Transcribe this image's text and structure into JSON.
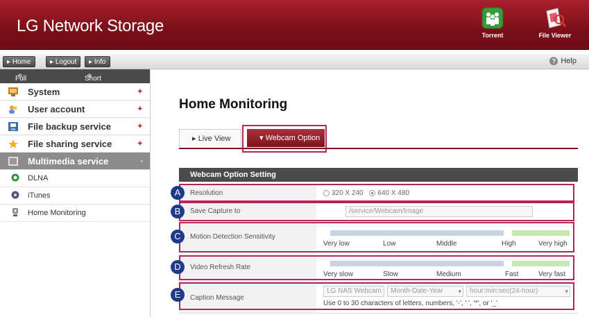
{
  "header": {
    "title": "LG Network Storage",
    "torrent_label": "Torrent",
    "fileviewer_label": "File Viewer"
  },
  "toolbar": {
    "home": "Home",
    "logout": "Logout",
    "info": "Info",
    "help": "Help"
  },
  "sidebar": {
    "full_menu": "Full Menu",
    "short_menu": "Short Menu",
    "categories": [
      {
        "label": "System"
      },
      {
        "label": "User account"
      },
      {
        "label": "File backup service"
      },
      {
        "label": "File sharing service"
      },
      {
        "label": "Multimedia service"
      }
    ],
    "sub_items": [
      {
        "label": "DLNA"
      },
      {
        "label": "iTunes"
      },
      {
        "label": "Home Monitoring"
      }
    ]
  },
  "main": {
    "title": "Home Monitoring",
    "tabs": [
      {
        "label": "Live View"
      },
      {
        "label": "Webcam Option"
      }
    ],
    "section_title": "Webcam Option Setting",
    "resolution": {
      "label": "Resolution",
      "option1": "320 X 240",
      "option2": "640 X 480",
      "selected": "640 X 480"
    },
    "save_capture": {
      "label": "Save Capture to",
      "value": "/service/Webcam/Image"
    },
    "motion": {
      "label": "Motion Detection Sensitivity",
      "ticks": [
        "Very low",
        "Low",
        "Middle",
        "High",
        "Very high"
      ]
    },
    "refresh": {
      "label": "Video Refresh Rate",
      "ticks": [
        "Very slow",
        "Slow",
        "Medium",
        "Fast",
        "Very fast"
      ]
    },
    "caption": {
      "label": "Caption Message",
      "text_value": "LG NAS Webcam",
      "date_format": "Month-Date-Year",
      "time_format": "hour:min:sec(24-hour)",
      "hint": "Use 0 to 30 characters of letters, numbers, '-', ' ', '*', or '_'"
    },
    "badges": [
      "A",
      "B",
      "C",
      "D",
      "E"
    ]
  },
  "colors": {
    "brand": "#7c0f19",
    "highlight": "#b5245b",
    "badge": "#1f3a8c"
  }
}
